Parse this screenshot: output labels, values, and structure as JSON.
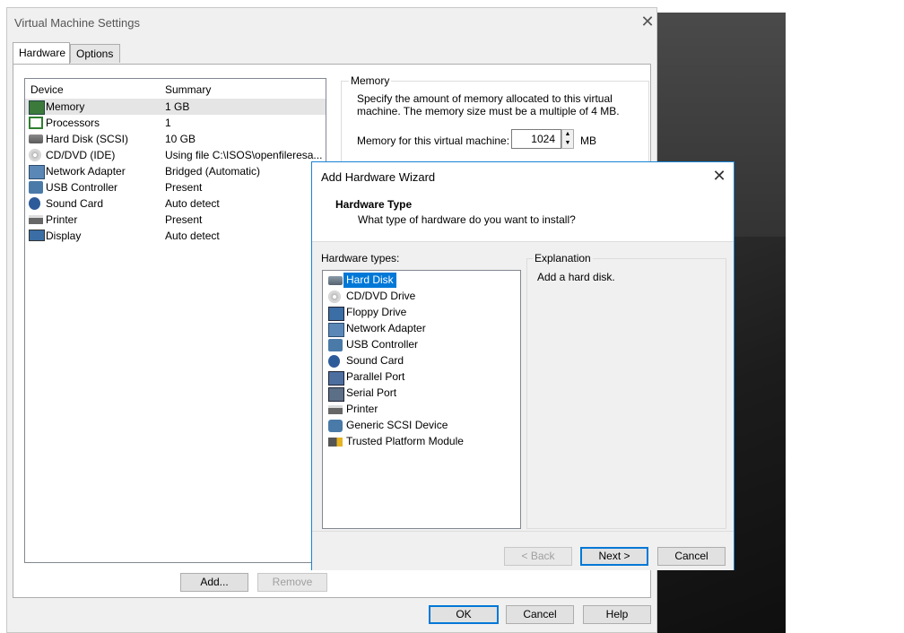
{
  "vm_settings": {
    "title": "Virtual Machine Settings",
    "tabs": [
      {
        "label": "Hardware",
        "active": true
      },
      {
        "label": "Options",
        "active": false
      }
    ],
    "device_list": {
      "columns": [
        "Device",
        "Summary"
      ],
      "rows": [
        {
          "device": "Memory",
          "summary": "1 GB",
          "icon": "memory-icon",
          "selected": true
        },
        {
          "device": "Processors",
          "summary": "1",
          "icon": "processor-icon"
        },
        {
          "device": "Hard Disk (SCSI)",
          "summary": "10 GB",
          "icon": "hard-disk-icon"
        },
        {
          "device": "CD/DVD (IDE)",
          "summary": "Using file C:\\ISOS\\openfileresa...",
          "icon": "cd-dvd-icon"
        },
        {
          "device": "Network Adapter",
          "summary": "Bridged (Automatic)",
          "icon": "network-adapter-icon"
        },
        {
          "device": "USB Controller",
          "summary": "Present",
          "icon": "usb-icon"
        },
        {
          "device": "Sound Card",
          "summary": "Auto detect",
          "icon": "sound-card-icon"
        },
        {
          "device": "Printer",
          "summary": "Present",
          "icon": "printer-icon"
        },
        {
          "device": "Display",
          "summary": "Auto detect",
          "icon": "display-icon"
        }
      ]
    },
    "add_button": "Add...",
    "remove_button": "Remove",
    "memory": {
      "legend": "Memory",
      "description": "Specify the amount of memory allocated to this virtual machine. The memory size must be a multiple of 4 MB.",
      "label": "Memory for this virtual machine:",
      "value": "1024",
      "unit": "MB"
    },
    "ok_button": "OK",
    "cancel_button": "Cancel",
    "help_button": "Help"
  },
  "wizard": {
    "title": "Add Hardware Wizard",
    "heading": "Hardware Type",
    "subheading": "What type of hardware do you want to install?",
    "types_label": "Hardware types:",
    "types": [
      {
        "label": "Hard Disk",
        "icon": "hard-disk-icon",
        "selected": true
      },
      {
        "label": "CD/DVD Drive",
        "icon": "cd-dvd-icon"
      },
      {
        "label": "Floppy Drive",
        "icon": "floppy-icon"
      },
      {
        "label": "Network Adapter",
        "icon": "network-adapter-icon"
      },
      {
        "label": "USB Controller",
        "icon": "usb-icon"
      },
      {
        "label": "Sound Card",
        "icon": "sound-card-icon"
      },
      {
        "label": "Parallel Port",
        "icon": "parallel-port-icon"
      },
      {
        "label": "Serial Port",
        "icon": "serial-port-icon"
      },
      {
        "label": "Printer",
        "icon": "printer-icon"
      },
      {
        "label": "Generic SCSI Device",
        "icon": "scsi-icon"
      },
      {
        "label": "Trusted Platform Module",
        "icon": "tpm-icon"
      }
    ],
    "explanation_legend": "Explanation",
    "explanation_text": "Add a hard disk.",
    "back_button": "< Back",
    "next_button": "Next >",
    "cancel_button": "Cancel"
  },
  "colors": {
    "selection": "#0078d7",
    "dialog_bg": "#f0f0f0",
    "wizard_border": "#1883d7"
  }
}
